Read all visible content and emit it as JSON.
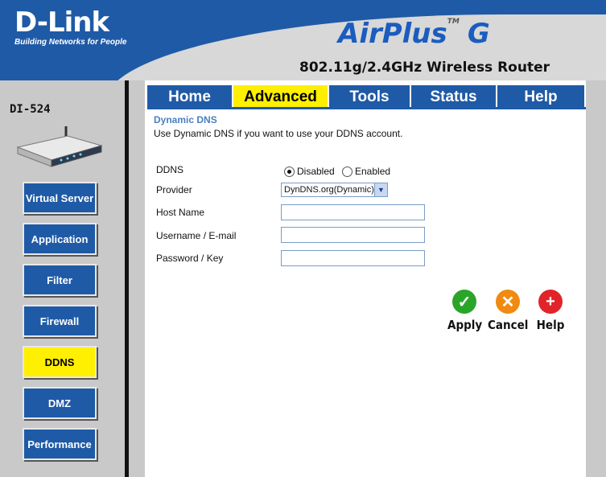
{
  "header": {
    "brand": "D-Link",
    "tagline": "Building Networks for People",
    "product": "AirPlus",
    "product_suffix": "G",
    "trademark": "TM",
    "model": "802.11g/2.4GHz Wireless Router"
  },
  "sidebar": {
    "device_label": "DI-524",
    "items": [
      {
        "label": "Virtual Server"
      },
      {
        "label": "Application"
      },
      {
        "label": "Filter"
      },
      {
        "label": "Firewall"
      },
      {
        "label": "DDNS",
        "active": true
      },
      {
        "label": "DMZ"
      },
      {
        "label": "Performance"
      }
    ]
  },
  "tabs": [
    {
      "label": "Home"
    },
    {
      "label": "Advanced",
      "active": true
    },
    {
      "label": "Tools"
    },
    {
      "label": "Status"
    },
    {
      "label": "Help"
    }
  ],
  "main": {
    "title": "Dynamic DNS",
    "description": "Use Dynamic DNS if you want to use your DDNS account.",
    "ddns_label": "DDNS",
    "ddns_options": [
      "Disabled",
      "Enabled"
    ],
    "ddns_selected": "Disabled",
    "provider_label": "Provider",
    "provider_value": "DynDNS.org(Dynamic)",
    "host_label": "Host Name",
    "host_value": "",
    "username_label": "Username / E-mail",
    "username_value": "",
    "password_label": "Password / Key",
    "password_value": ""
  },
  "actions": {
    "apply": "Apply",
    "cancel": "Cancel",
    "help": "Help"
  },
  "colors": {
    "brand_blue": "#1f5aa6",
    "active_yellow": "#ffef00",
    "apply_green": "#2aa52a",
    "cancel_orange": "#f08a10",
    "help_red": "#e0242a"
  }
}
